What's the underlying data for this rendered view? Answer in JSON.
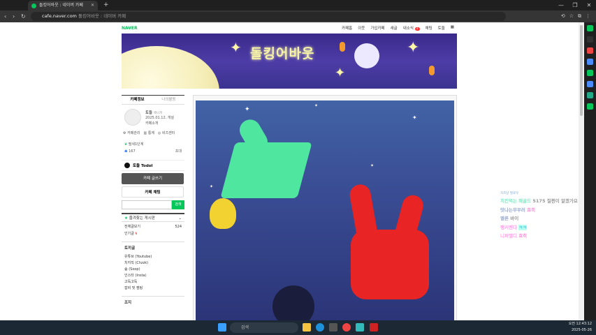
{
  "browser": {
    "tab_title": "돌킹어바웃 : 네이버 카페",
    "new_tab": "+",
    "url_host": "cafe.naver.com",
    "url_rest": "돌킹어바웃 : 네이버 카페",
    "back": "‹",
    "forward": "›",
    "reload": "↻",
    "win_min": "—",
    "win_max": "❐",
    "win_close": "✕",
    "tab_close": "✕"
  },
  "gnb": {
    "logo": "NAVER",
    "menu": [
      "카페홈",
      "이웃",
      "가입카페",
      "새글",
      "내소식",
      "채팅",
      "토들"
    ],
    "notif_count": "3"
  },
  "banner": {
    "title": "돌킹어바웃"
  },
  "sidebar": {
    "tab_info": "카페정보",
    "tab_activity": "나의활동",
    "owner_name": "토들",
    "owner_rank": "매니저",
    "since": "2025.01.12. 개설",
    "intro": "카페소개",
    "admin_links": [
      "카페관리",
      "통계",
      "비즈센터"
    ],
    "level": "필새1단계",
    "member_count": "167",
    "invite": "초대",
    "todol_label": "토들 Todol",
    "write_button": "카페 글쓰기",
    "chat_button": "카페 채팅",
    "search_button": "검색",
    "favs_title": "즐겨찾는 게시판",
    "all_posts": "전체글보기",
    "all_posts_count": "524",
    "popular": "인기글",
    "new_badge": "N",
    "group_title": "토끼굴",
    "boards": [
      "유튜브 (Youtube)",
      "치지직 (Chzzk)",
      "숲 (Soop)",
      "인스타 (Insta)",
      "고독고독",
      "잡비 및 잼팅"
    ],
    "group2_title": "조지"
  },
  "chat_overlay": {
    "header": "치즈냥   팔로우",
    "lines": [
      {
        "user": "치킨먹는 해골드",
        "msg": "5175 질쩐이 알겠가요"
      },
      {
        "user": "맛나는무우러",
        "msg": "흐히"
      },
      {
        "user": "멜론",
        "msg": "바이"
      },
      {
        "user": "팽키멘다",
        "msg": "ㅋㅋ"
      },
      {
        "user": "니퍼엘디",
        "msg": "흐히"
      }
    ]
  },
  "taskbar": {
    "search_placeholder": "검색",
    "time": "오전 12:43:12",
    "date": "2025-05-26"
  },
  "colors": {
    "naver_green": "#03c75a",
    "banner_purple": "#4d3ca6",
    "chat_green": "#7ee8c4",
    "chat_pink": "#ff9ee8"
  }
}
